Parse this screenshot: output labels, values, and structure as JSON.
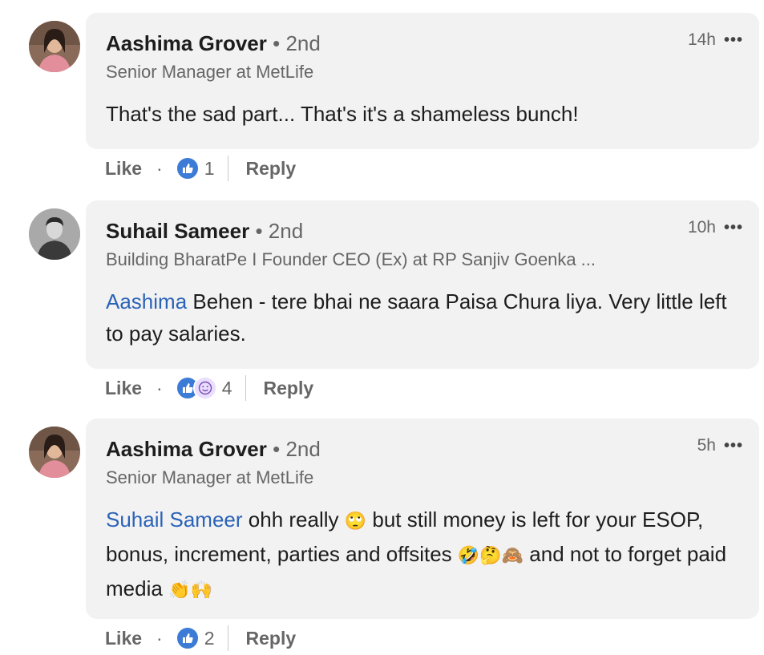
{
  "comments": [
    {
      "author": "Aashima Grover",
      "separator": "•",
      "degree": "2nd",
      "headline": "Senior Manager at MetLife",
      "time": "14h",
      "more_label": "•••",
      "mention": "",
      "text": "That's the sad part... That's it's a shameless bunch!",
      "like_label": "Like",
      "reaction_icons": [
        "like-icon"
      ],
      "reaction_count": "1",
      "reply_label": "Reply"
    },
    {
      "author": "Suhail Sameer",
      "separator": "•",
      "degree": "2nd",
      "headline": "Building BharatPe I Founder CEO (Ex) at RP Sanjiv Goenka ...",
      "time": "10h",
      "more_label": "•••",
      "mention": "Aashima",
      "text": " Behen - tere bhai ne saara Paisa Chura liya. Very little left to pay salaries.",
      "like_label": "Like",
      "reaction_icons": [
        "like-icon",
        "funny-icon"
      ],
      "reaction_count": "4",
      "reply_label": "Reply"
    },
    {
      "author": "Aashima Grover",
      "separator": "•",
      "degree": "2nd",
      "headline": "Senior Manager at MetLife",
      "time": "5h",
      "more_label": "•••",
      "mention": "Suhail Sameer",
      "text_part1": " ohh really ",
      "emoji1": "🙄",
      "text_part2": " but still money is left for your ESOP, bonus, increment, parties and offsites ",
      "emoji2": "🤣🤔🙈",
      "text_part3": " and not to forget paid media ",
      "emoji3": "👏🙌",
      "like_label": "Like",
      "reaction_icons": [
        "like-icon"
      ],
      "reaction_count": "2",
      "reply_label": "Reply"
    }
  ],
  "colors": {
    "bubble": "#f2f2f2",
    "mention": "#2b63b8",
    "like_reaction": "#3c7bd6",
    "secondary_text": "#666666"
  }
}
